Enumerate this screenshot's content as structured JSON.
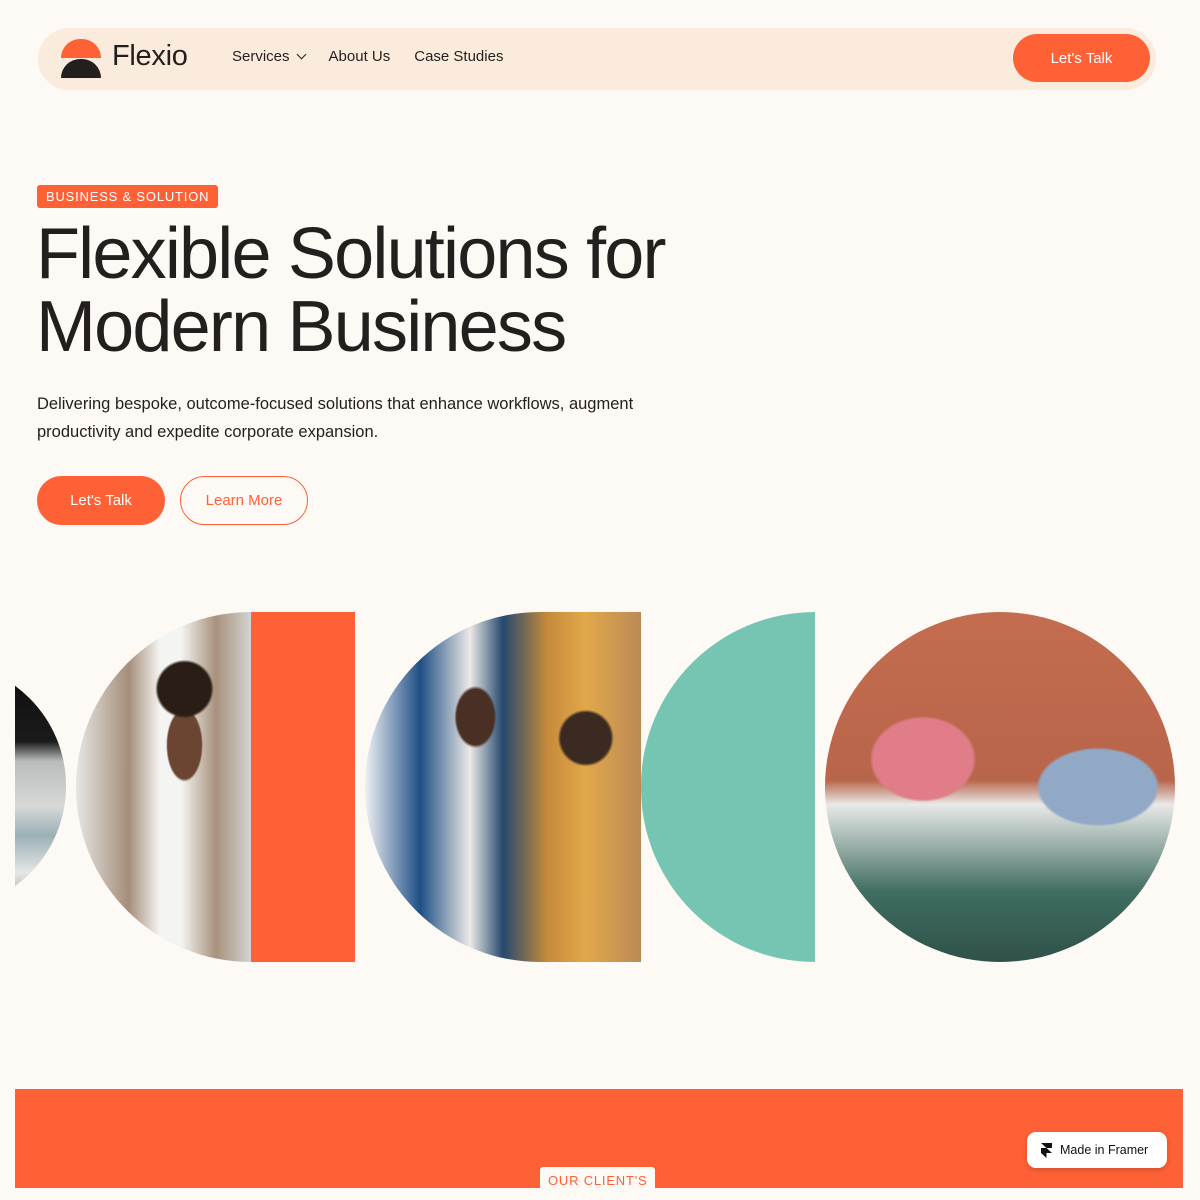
{
  "nav": {
    "brand": "Flexio",
    "links": [
      {
        "label": "Services",
        "has_dropdown": true
      },
      {
        "label": "About Us"
      },
      {
        "label": "Case Studies"
      }
    ],
    "cta_label": "Let's Talk"
  },
  "hero": {
    "badge": "BUSINESS & SOLUTION",
    "headline_line1": "Flexible Solutions for",
    "headline_line2": "Modern Business",
    "subtitle": "Delivering bespoke, outcome-focused solutions that enhance workflows, augment productivity and expedite corporate expansion.",
    "primary_button": "Let's Talk",
    "secondary_button": "Learn More"
  },
  "gallery": {
    "items": [
      "photo-office-partial",
      "photo-man-with-tablet",
      "orange-block",
      "photo-colleagues-talking",
      "teal-half-circle",
      "photo-two-people-by-window"
    ]
  },
  "clients": {
    "badge": "OUR CLIENT'S"
  },
  "framer_badge": {
    "label": "Made in Framer",
    "icon": "framer-logo-icon"
  },
  "colors": {
    "accent": "#ff6136",
    "teal": "#76c5b3",
    "background": "#fdf9f5",
    "nav_background": "#fbebdd",
    "text": "#231f1e"
  }
}
